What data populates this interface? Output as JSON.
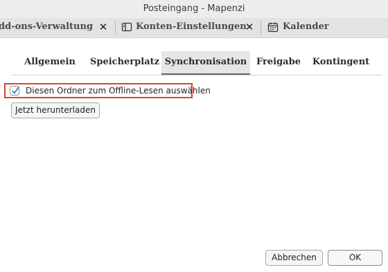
{
  "window": {
    "title": "Posteingang - Mapenzi"
  },
  "tabs": [
    {
      "label": "dd-ons-Verwaltung",
      "icon": "puzzle-icon"
    },
    {
      "label": "Konten-Einstellungen",
      "icon": "sidebar-panel-icon"
    },
    {
      "label": "Kalender",
      "icon": "calendar-icon"
    }
  ],
  "close_glyph": "✕",
  "subtabs": [
    "Allgemein",
    "Speicherplatz",
    "Synchronisation",
    "Freigabe",
    "Kontingent"
  ],
  "active_subtab": "Synchronisation",
  "sync": {
    "offline_checkbox_label": "Diesen Ordner zum Offline-Lesen auswählen",
    "offline_checked": true,
    "download_button": "Jetzt herunterladen"
  },
  "dialog": {
    "cancel_button": "Abbrechen",
    "ok_button": "OK"
  },
  "colors": {
    "highlight": "#d6452f",
    "check": "#1f6fd1"
  }
}
